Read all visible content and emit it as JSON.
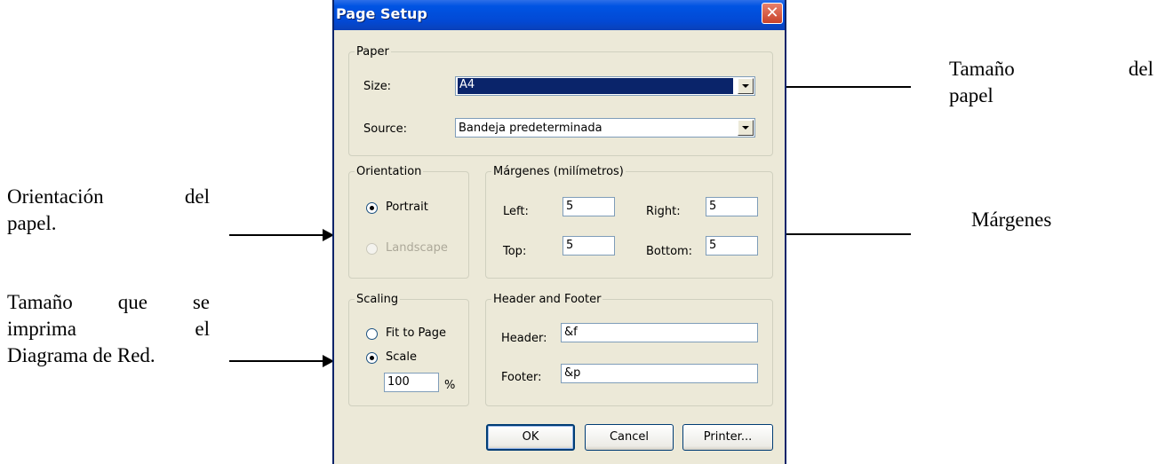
{
  "dialog": {
    "title": "Page Setup",
    "close_glyph": "✕",
    "paper": {
      "legend": "Paper",
      "size_label": "Size:",
      "size_value": "A4",
      "source_label": "Source:",
      "source_value": "Bandeja predeterminada"
    },
    "orientation": {
      "legend": "Orientation",
      "portrait_label": "Portrait",
      "landscape_label": "Landscape",
      "selected": "Portrait"
    },
    "margins": {
      "legend": "Márgenes (milímetros)",
      "left_label": "Left:",
      "left_value": "5",
      "right_label": "Right:",
      "right_value": "5",
      "top_label": "Top:",
      "top_value": "5",
      "bottom_label": "Bottom:",
      "bottom_value": "5"
    },
    "scaling": {
      "legend": "Scaling",
      "fit_label": "Fit to Page",
      "scale_label": "Scale",
      "scale_value": "100",
      "percent": "%",
      "selected": "Scale"
    },
    "header_footer": {
      "legend": "Header and Footer",
      "header_label": "Header:",
      "header_value": "&f",
      "footer_label": "Footer:",
      "footer_value": "&p"
    },
    "buttons": {
      "ok": "OK",
      "cancel": "Cancel",
      "printer": "Printer..."
    }
  },
  "annotations": {
    "paper_size_line1_a": "Tamaño",
    "paper_size_line1_b": "del",
    "paper_size_line2": "papel",
    "orientation_line1_a": "Orientación",
    "orientation_line1_b": "del",
    "orientation_line2": "papel.",
    "margins": "Márgenes",
    "scaling_line1_a": "Tamaño",
    "scaling_line1_b": "que",
    "scaling_line1_c": "se",
    "scaling_line2_a": "imprima",
    "scaling_line2_b": "el",
    "scaling_line3": "Diagrama de Red."
  }
}
